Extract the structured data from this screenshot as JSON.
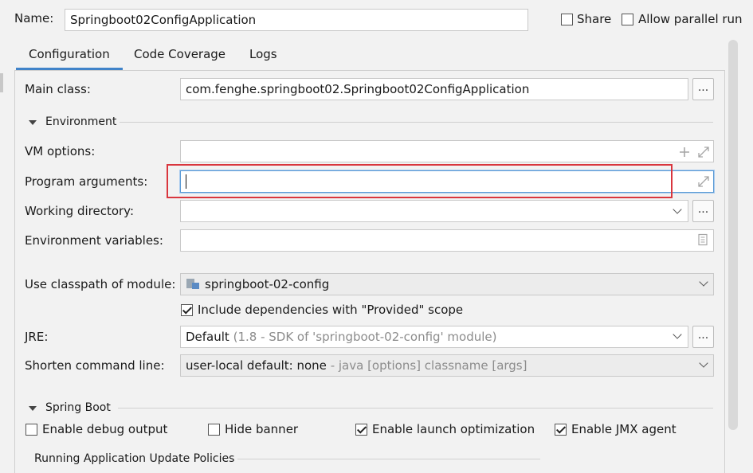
{
  "header": {
    "name_label": "Name:",
    "name_value": "Springboot02ConfigApplication",
    "share_label": "Share",
    "share_checked": false,
    "parallel_label": "Allow parallel run",
    "parallel_checked": false
  },
  "tabs": [
    {
      "label": "Configuration",
      "active": true
    },
    {
      "label": "Code Coverage",
      "active": false
    },
    {
      "label": "Logs",
      "active": false
    }
  ],
  "form": {
    "main_class_label": "Main class:",
    "main_class_value": "com.fenghe.springboot02.Springboot02ConfigApplication",
    "main_class_button": "...",
    "environment_section": "Environment",
    "vm_options_label": "VM options:",
    "vm_options_value": "",
    "program_args_label": "Program arguments:",
    "program_args_value": "",
    "working_dir_label": "Working directory:",
    "working_dir_value": "",
    "working_dir_button": "...",
    "env_vars_label": "Environment variables:",
    "env_vars_value": "",
    "classpath_label": "Use classpath of module:",
    "classpath_value": "springboot-02-config",
    "include_deps_label": "Include dependencies with \"Provided\" scope",
    "include_deps_checked": true,
    "jre_label": "JRE:",
    "jre_value": "Default",
    "jre_hint": "(1.8 - SDK of 'springboot-02-config' module)",
    "jre_button": "...",
    "shorten_label": "Shorten command line:",
    "shorten_value": "user-local default: none",
    "shorten_hint": "- java [options] classname [args]"
  },
  "spring_boot": {
    "section": "Spring Boot",
    "debug_label": "Enable debug output",
    "debug_checked": false,
    "hide_banner_label": "Hide banner",
    "hide_banner_checked": false,
    "launch_opt_label": "Enable launch optimization",
    "launch_opt_checked": true,
    "jmx_label": "Enable JMX agent",
    "jmx_checked": true,
    "update_policies_section": "Running Application Update Policies"
  },
  "colors": {
    "accent": "#4083c9",
    "highlight_box": "#d9363e",
    "focus_border": "#5b9bd5"
  }
}
